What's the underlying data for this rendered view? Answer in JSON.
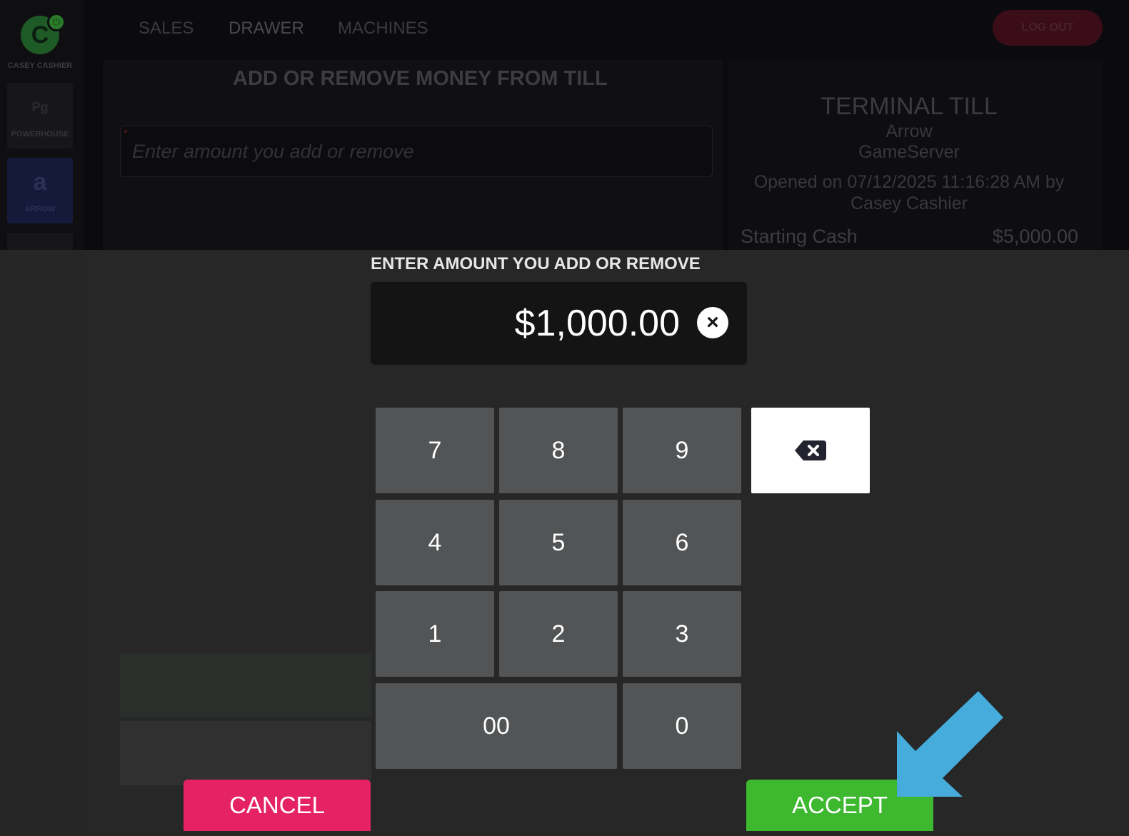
{
  "user": {
    "initial": "C",
    "name": "CASEY CASHIER"
  },
  "sidebar": {
    "items": [
      {
        "label": "POWERHOUSE",
        "icon": "Pg"
      },
      {
        "label": "ARROW",
        "icon": "a"
      }
    ]
  },
  "nav": {
    "tabs": [
      {
        "label": "SALES"
      },
      {
        "label": "DRAWER"
      },
      {
        "label": "MACHINES"
      }
    ],
    "logout_label": "LOG OUT"
  },
  "drawer": {
    "title": "ADD OR REMOVE MONEY FROM TILL",
    "input_placeholder": "Enter amount you add or remove"
  },
  "till": {
    "title": "TERMINAL TILL",
    "name": "Arrow",
    "server": "GameServer",
    "opened": "Opened on 07/12/2025 11:16:28 AM by Casey Cashier",
    "starting_cash_label": "Starting Cash",
    "starting_cash_value": "$5,000.00"
  },
  "dialog": {
    "label": "ENTER AMOUNT YOU ADD OR REMOVE",
    "amount": "$1,000.00",
    "clear_icon": "×",
    "keys": [
      "7",
      "8",
      "9",
      "4",
      "5",
      "6",
      "1",
      "2",
      "3",
      "00",
      "0"
    ],
    "backspace_icon": "backspace-icon",
    "cancel_label": "CANCEL",
    "accept_label": "ACCEPT"
  },
  "colors": {
    "cancel": "#e52263",
    "accept": "#3db82f",
    "pointer_arrow": "#45acdc",
    "key": "#525456"
  }
}
